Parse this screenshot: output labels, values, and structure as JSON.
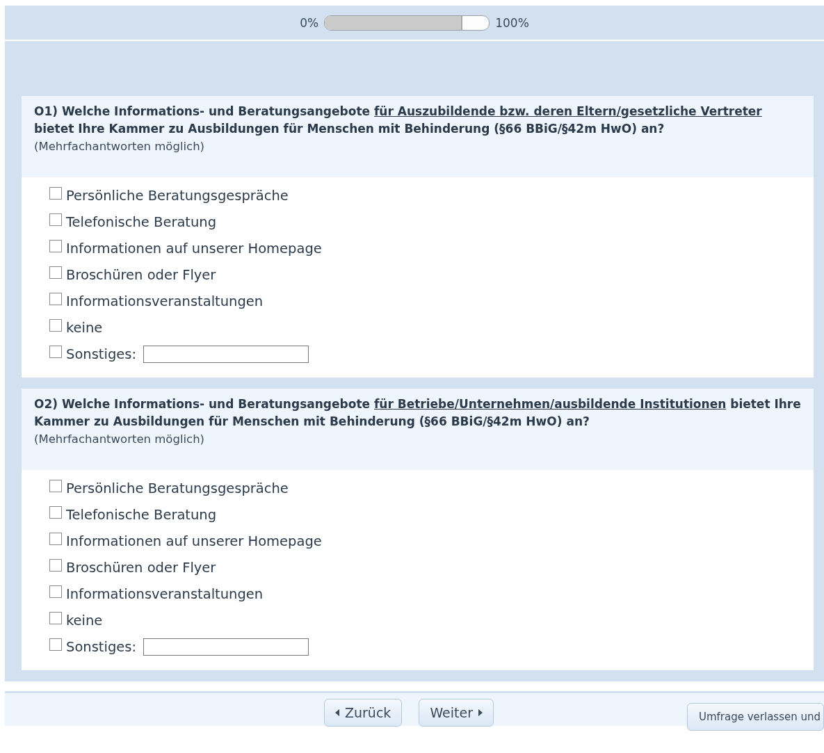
{
  "progress": {
    "start_label": "0%",
    "end_label": "100%",
    "level": 0.83
  },
  "questions": [
    {
      "number": "O1)",
      "segments": [
        {
          "text": "Welche Informations- und Beratungsangebote ",
          "underlined": false
        },
        {
          "text": "für Auszubildende bzw. deren Eltern/gesetzliche Vertreter",
          "underlined": true
        },
        {
          "text": " bietet Ihre Kammer zu Ausbildungen für Menschen mit Behinderung (§66 BBiG/§42m HwO) an?",
          "underlined": false
        }
      ],
      "hint": "(Mehrfachantworten möglich)",
      "options": [
        {
          "label": "Persönliche Beratungsgespräche",
          "checked": false
        },
        {
          "label": "Telefonische Beratung",
          "checked": false
        },
        {
          "label": "Informationen auf unserer Homepage",
          "checked": false
        },
        {
          "label": "Broschüren oder Flyer",
          "checked": false
        },
        {
          "label": "Informationsveranstaltungen",
          "checked": false
        },
        {
          "label": "keine",
          "checked": false
        },
        {
          "label": "Sonstiges:",
          "checked": false,
          "kind": "text"
        }
      ]
    },
    {
      "number": "O2)",
      "segments": [
        {
          "text": "Welche Informations- und Beratungsangebote ",
          "underlined": false
        },
        {
          "text": "für Betriebe/Unternehmen/ausbildende Institutionen",
          "underlined": true
        },
        {
          "text": " bietet Ihre Kammer zu Ausbildungen für Menschen mit Behinderung (§66 BBiG/§42m HwO) an?",
          "underlined": false
        }
      ],
      "hint": "(Mehrfachantworten möglich)",
      "options": [
        {
          "label": "Persönliche Beratungsgespräche",
          "checked": false
        },
        {
          "label": "Telefonische Beratung",
          "checked": false
        },
        {
          "label": "Informationen auf unserer Homepage",
          "checked": false
        },
        {
          "label": "Broschüren oder Flyer",
          "checked": false
        },
        {
          "label": "Informationsveranstaltungen",
          "checked": false
        },
        {
          "label": "keine",
          "checked": false
        },
        {
          "label": "Sonstiges:",
          "checked": false,
          "kind": "text"
        }
      ]
    }
  ],
  "footer": {
    "back_button": "Zurück",
    "next_button": "Weiter",
    "exit_button": "Umfrage verlassen und"
  }
}
